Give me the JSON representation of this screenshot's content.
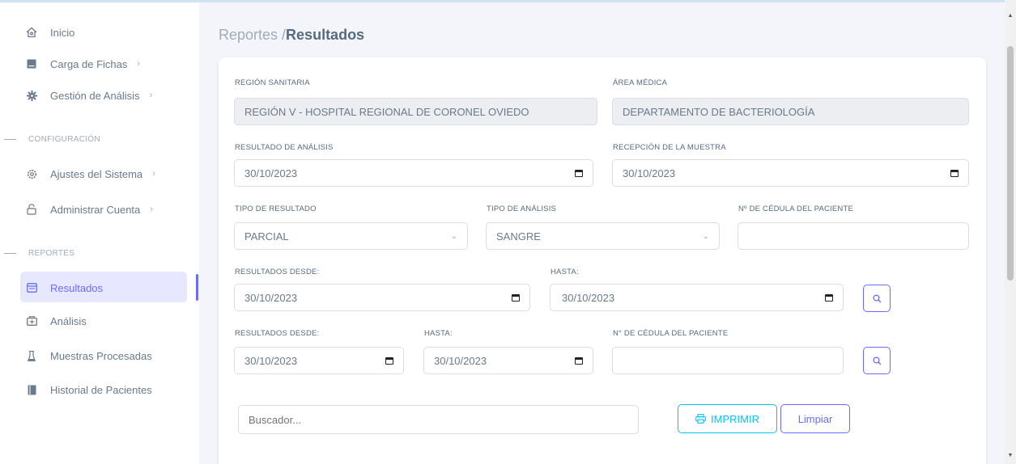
{
  "sidebar": {
    "items": [
      {
        "label": "Inicio",
        "icon": "home-icon"
      },
      {
        "label": "Carga de Fichas",
        "icon": "file-icon"
      },
      {
        "label": "Gestión de Análisis",
        "icon": "gear-icon"
      }
    ],
    "config_section": "CONFIGURACIÓN",
    "config_items": [
      {
        "label": "Ajustes del Sistema",
        "icon": "settings-icon"
      },
      {
        "label": "Administrar Cuenta",
        "icon": "lock-icon"
      }
    ],
    "reports_section": "REPORTES",
    "report_items": [
      {
        "label": "Resultados",
        "icon": "window-icon"
      },
      {
        "label": "Análisis",
        "icon": "box-icon"
      },
      {
        "label": "Muestras Procesadas",
        "icon": "flask-icon"
      },
      {
        "label": "Historial de Pacientes",
        "icon": "book-icon"
      }
    ],
    "chevron": "›"
  },
  "breadcrumb": {
    "parent": "Reportes /",
    "current": "Resultados"
  },
  "form": {
    "region_label": "REGIÓN SANITARIA",
    "region_value": "REGIÓN V - HOSPITAL REGIONAL DE CORONEL OVIEDO",
    "area_label": "ÁREA MÉDICA",
    "area_value": "DEPARTAMENTO DE BACTERIOLOGÍA",
    "resultado_label": "RESULTADO DE ANÁLISIS",
    "resultado_value": "30/10/2023",
    "recepcion_label": "RECEPCIÓN DE LA MUESTRA",
    "recepcion_value": "30/10/2023",
    "tipo_resultado_label": "TIPO DE RESULTADO",
    "tipo_resultado_value": "PARCIAL",
    "tipo_analisis_label": "TIPO DE ANÁLISIS",
    "tipo_analisis_value": "SANGRE",
    "cedula_label": "Nº DE CÉDULA DEL PACIENTE",
    "cedula_value": "",
    "desde1_label": "RESULTADOS DESDE:",
    "desde1_value": "30/10/2023",
    "hasta1_label": "HASTA:",
    "hasta1_value": "30/10/2023",
    "desde2_label": "RESULTADOS DESDE:",
    "desde2_value": "30/10/2023",
    "hasta2_label": "HASTA:",
    "hasta2_value": "30/10/2023",
    "cedula2_label": "N° DE CÉDULA DEL PACIENTE",
    "cedula2_value": ""
  },
  "search": {
    "placeholder": "Buscador..."
  },
  "actions": {
    "print_label": "IMPRIMIR",
    "clear_label": "Limpiar"
  },
  "colors": {
    "primary": "#696cff",
    "info": "#03c3ec",
    "active_bg": "#e7e7ff"
  }
}
